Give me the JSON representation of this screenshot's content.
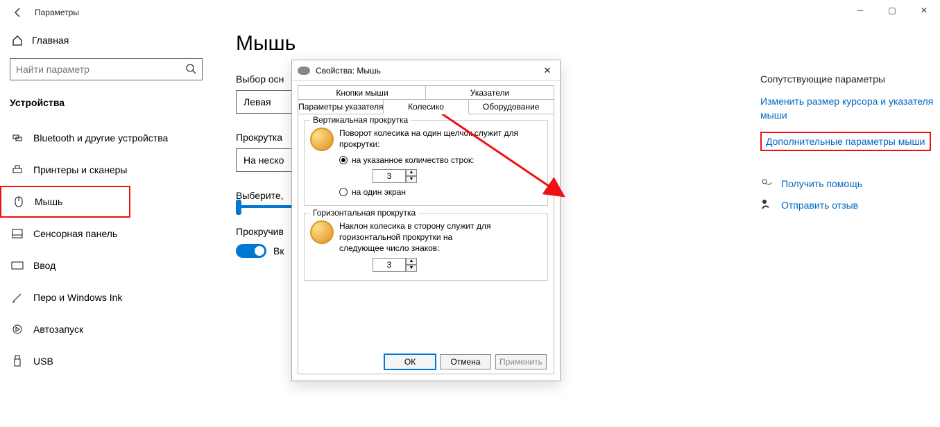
{
  "header": {
    "title": "Параметры"
  },
  "sidebar": {
    "home": "Главная",
    "search_placeholder": "Найти параметр",
    "category": "Устройства",
    "items": [
      {
        "label": "Bluetooth и другие устройства",
        "id": "bluetooth"
      },
      {
        "label": "Принтеры и сканеры",
        "id": "printers"
      },
      {
        "label": "Мышь",
        "id": "mouse",
        "selected": true
      },
      {
        "label": "Сенсорная панель",
        "id": "touchpad"
      },
      {
        "label": "Ввод",
        "id": "typing"
      },
      {
        "label": "Перо и Windows Ink",
        "id": "pen"
      },
      {
        "label": "Автозапуск",
        "id": "autoplay"
      },
      {
        "label": "USB",
        "id": "usb"
      }
    ]
  },
  "main": {
    "title": "Мышь",
    "primary_label": "Выбор осн",
    "primary_value": "Левая",
    "scroll_label": "Прокрутка",
    "scroll_value": "На неско",
    "lines_label": "Выберите,",
    "inactive_label": "Прокручив",
    "toggle_value": "Вк"
  },
  "rlinks": {
    "heading": "Сопутствующие параметры",
    "link1": "Изменить размер курсора и указателя мыши",
    "link2": "Дополнительные параметры мыши",
    "help": "Получить помощь",
    "feedback": "Отправить отзыв"
  },
  "dialog": {
    "title": "Свойства: Мышь",
    "tabs": {
      "r1a": "Кнопки мыши",
      "r1b": "Указатели",
      "r2a": "Параметры указателя",
      "r2b": "Колесико",
      "r2c": "Оборудование"
    },
    "vgroup": {
      "legend": "Вертикальная прокрутка",
      "text": "Поворот колесика на один щелчок служит для прокрутки:",
      "radio1": "на указанное количество строк:",
      "radio2": "на один экран",
      "value": "3"
    },
    "hgroup": {
      "legend": "Горизонтальная прокрутка",
      "text": "Наклон колесика в сторону служит для горизонтальной прокрутки на следующее число знаков:",
      "value": "3"
    },
    "btns": {
      "ok": "ОК",
      "cancel": "Отмена",
      "apply": "Применить"
    }
  }
}
